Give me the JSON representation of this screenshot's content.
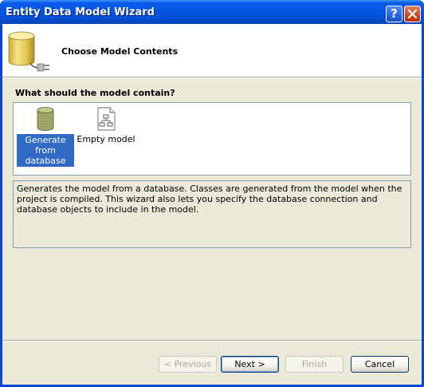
{
  "window": {
    "title": "Entity Data Model Wizard",
    "help_glyph": "?"
  },
  "header": {
    "title": "Choose Model Contents",
    "icon": "database-plug-icon"
  },
  "question": "What should the model contain?",
  "model_options": [
    {
      "label": "Generate from database",
      "icon": "database-icon",
      "selected": true
    },
    {
      "label": "Empty model",
      "icon": "hierarchy-document-icon",
      "selected": false
    }
  ],
  "description": "Generates the model from a database. Classes are generated from the model when the project is compiled. This wizard also lets you specify the database connection and database objects to include in the model.",
  "buttons": {
    "previous": "< Previous",
    "next": "Next >",
    "finish": "Finish",
    "cancel": "Cancel"
  },
  "colors": {
    "titlebar": "#0a5ee8",
    "selection": "#316ac5",
    "dialog_bg": "#ece9d8"
  }
}
